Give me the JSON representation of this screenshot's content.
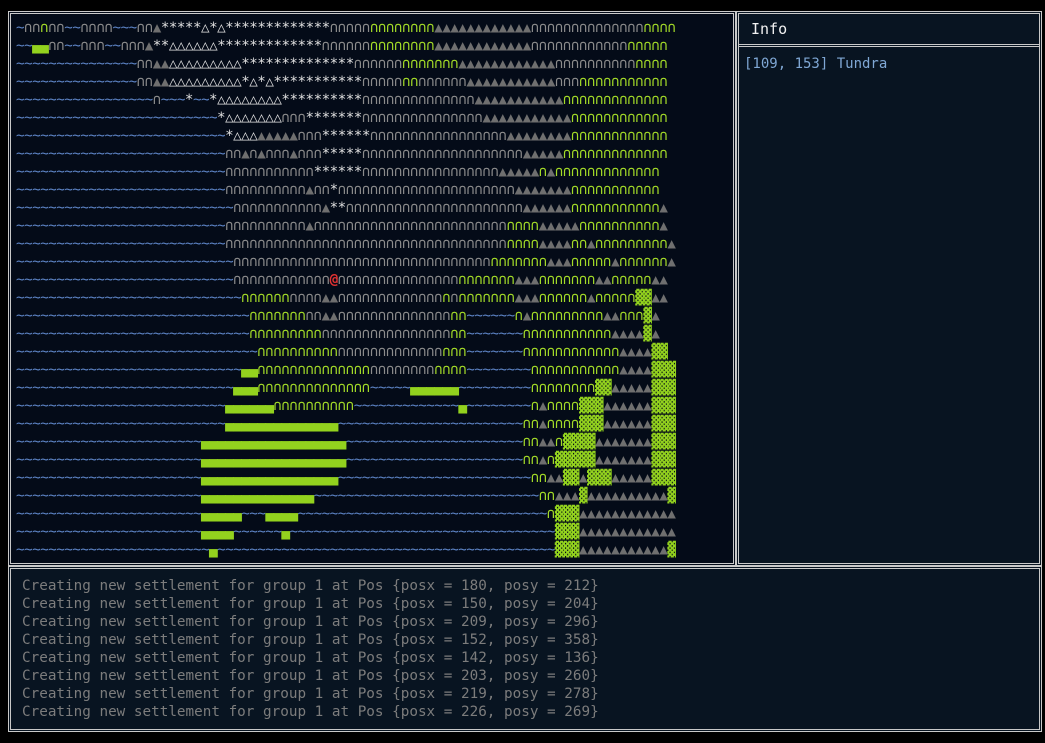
{
  "info": {
    "title": "Info",
    "cursor_text": "[109, 153] Tundra"
  },
  "log": [
    "Creating new settlement for group 1 at Pos {posx = 180, posy = 212}",
    "Creating new settlement for group 1 at Pos {posx = 150, posy = 204}",
    "Creating new settlement for group 1 at Pos {posx = 209, posy = 296}",
    "Creating new settlement for group 1 at Pos {posx = 152, posy = 358}",
    "Creating new settlement for group 1 at Pos {posx = 142, posy = 136}",
    "Creating new settlement for group 1 at Pos {posx = 203, posy = 260}",
    "Creating new settlement for group 1 at Pos {posx = 219, posy = 278}",
    "Creating new settlement for group 1 at Pos {posx = 226, posy = 269}"
  ],
  "map": {
    "legend": {
      "~": "water",
      "n": "tundra",
      "F": "forest",
      "^": "mountains",
      "*": "snow",
      "A": "peaks",
      "=": "grassland",
      "#": "plains",
      "@": "player"
    },
    "rows": [
      "~nnFnn~~nnnn~~~nn^*****A*A*************nnnnnFFFFFFFF^^^^^^^^^^^^nnnnnnnnnnnnnnFFFF",
      "~~==nn~~nnn~~nnn^**AAAAAA*************nnnnnnFFFFFFFF^^^^^^^^^^^^nnnnnnnnnnnnFFFFF",
      "~~~~~~~~~~~~~~~nn^^AAAAAAAAA**************nnnnnnFFFFFFF^^^^^^^^^^^^nnnnnnnnnnFFFF",
      "~~~~~~~~~~~~~~~nn^^AAAAAAAAA*A*A***********nnnnnFFnnnnnn^^^^^^^^^^^nnnFFFFFFFFFFF",
      "~~~~~~~~~~~~~~~~~n~~~*~~*AAAAAAAA**********nnnnnnnnnnnnnn^^^^^^^^^^^FFFFFFFFFFFFF",
      "~~~~~~~~~~~~~~~~~~~~~~~~~*AAAAAAAnnn*******nnnnnnnnnnnnnnn^^^^^^^^^^^FFFFFFFFFFFF",
      "~~~~~~~~~~~~~~~~~~~~~~~~~~*AAA^^^^^nnn******nnnnnnnnnnnnnnnnn^^^^^^^^FFFFFFFFFFFF",
      "~~~~~~~~~~~~~~~~~~~~~~~~~~nn^n^nnn^nnn*****nnnnnnnnnnnnnnnnnnnn^^^^^FFFFFFFFFFFFF",
      "~~~~~~~~~~~~~~~~~~~~~~~~~~nnnnnnnnnnn******nnnnnnnnnnnnnnnnn^^^^^F^FFFFFFFFFFFFF",
      "~~~~~~~~~~~~~~~~~~~~~~~~~~nnnnnnnnnn^nn*nnnnnnnnnnnnnnnnnnnnnn^^^^^^^FFFFFFFFFFF",
      "~~~~~~~~~~~~~~~~~~~~~~~~~~~nnnnnnnnnnn^**nnnnnnnnnnnnnnnnnnnnnn^^^^^^FFFFFFFFFFF^",
      "~~~~~~~~~~~~~~~~~~~~~~~~~~nnnnnnnnnn^nnnnnnnnnnnnnnnnnnnnnnnnFFFF^^^^^FFFFFFFFFF^",
      "~~~~~~~~~~~~~~~~~~~~~~~~~~nnnnnnnnnnnnnnnnnnnnnnnnnnnnnnnnnnnFFFF^^^^FF^FFFFFFFFF^",
      "~~~~~~~~~~~~~~~~~~~~~~~~~~~nnnnnnnnnnnnnnnnnnnnnnnnnnnnnnnnFFFFFFF^^^FFFFF^FFFFFF^",
      "~~~~~~~~~~~~~~~~~~~~~~~~~~~nnnnnnnnnnnn@nnnnnnnnnnnnnnnFFFFFFF^^^FFFFFFF^^FFFFF^^",
      "~~~~~~~~~~~~~~~~~~~~~~~~~~~~FFFFFFnnnn^^nnnnnnnnnnnnnFnFFFFFFF^^^FFFFFF^FFFFF##^^",
      "~~~~~~~~~~~~~~~~~~~~~~~~~~~~~FFFFFFFnn^^nnnnnnnnnnnnnnFF~~~~~~F^FFFFFFFFF^^FFF#^",
      "~~~~~~~~~~~~~~~~~~~~~~~~~~~~~FFFFFFFFFnnnnnnnnnnnnnnnnFF~~~~~~~FFFFFFFFFFF^^^^#^",
      "~~~~~~~~~~~~~~~~~~~~~~~~~~~~~~FFFFFFFFFFnnnnnnnnnnnnnFFF~~~~~~~FFFFFFFFFFFF^^^^##",
      "~~~~~~~~~~~~~~~~~~~~~~~~~~~~==FFFFFFFFFFFFFFnnnnnnnnFFFF~~~~~~~~FFFFFFFFFFF^^^^###",
      "~~~~~~~~~~~~~~~~~~~~~~~~~~~===FFFFFFFFFFFFFF~~~~~======~~~~~~~~~FFFFFFFF##^^^^^###",
      "~~~~~~~~~~~~~~~~~~~~~~~~~~======FFFFFFFFFF~~~~~~~~~~~~~=~~~~~~~~F^FFFF###^^^^^^###",
      "~~~~~~~~~~~~~~~~~~~~~~~~~~==============~~~~~~~~~~~~~~~~~~~~~~~FF^FFFF###^^^^^^###",
      "~~~~~~~~~~~~~~~~~~~~~~~==================~~~~~~~~~~~~~~~~~~~~~~FF^^F####^^^^^^^###",
      "~~~~~~~~~~~~~~~~~~~~~~~==================~~~~~~~~~~~~~~~~~~~~~~FF^F#####^^^^^^^###",
      "~~~~~~~~~~~~~~~~~~~~~~~=================~~~~~~~~~~~~~~~~~~~~~~~~FF^^##^###^^^^^###",
      "~~~~~~~~~~~~~~~~~~~~~~~==============~~~~~~~~~~~~~~~~~~~~~~~~~~~~FF^^^#^^^^^^^^^^#",
      "~~~~~~~~~~~~~~~~~~~~~~~=====~~~====~~~~~~~~~~~~~~~~~~~~~~~~~~~~~~~F###^^^^^^^^^^^^",
      "~~~~~~~~~~~~~~~~~~~~~~~====~~~~~~=~~~~~~~~~~~~~~~~~~~~~~~~~~~~~~~~~###^^^^^^^^^^^^",
      "~~~~~~~~~~~~~~~~~~~~~~~~=~~~~~~~~~~~~~~~~~~~~~~~~~~~~~~~~~~~~~~~~~~###^^^^^^^^^^^#"
    ]
  }
}
